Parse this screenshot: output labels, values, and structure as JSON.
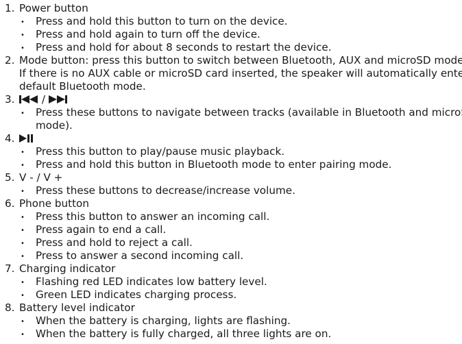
{
  "items": [
    {
      "number": "1.",
      "title": "Power button",
      "bullets": [
        "Press and hold this button to turn on the device.",
        "Press and hold again to turn off the device.",
        "Press and hold for about 8 seconds to restart the device."
      ]
    },
    {
      "number": "2.",
      "lines": [
        "Mode button: press this button to switch between Bluetooth, AUX and microSD modes.",
        "If there is no AUX cable or microSD card inserted, the speaker will automatically enter",
        "default Bluetooth mode."
      ]
    },
    {
      "number": "3.",
      "title_icons": [
        "previous-track-icon",
        "next-track-icon"
      ],
      "separator": "/",
      "bullets": [
        "Press these buttons to navigate between tracks (available in Bluetooth and microSD",
        "mode)."
      ]
    },
    {
      "number": "4.",
      "title_icons": [
        "play-pause-icon"
      ],
      "bullets": [
        "Press this button to play/pause music playback.",
        "Press and hold this button in Bluetooth mode to enter pairing mode."
      ]
    },
    {
      "number": "5.",
      "title": "V - / V +",
      "bullets": [
        "Press these buttons to decrease/increase volume."
      ]
    },
    {
      "number": "6.",
      "title": "Phone button",
      "bullets": [
        "Press this button to answer an incoming call.",
        "Press again to end a call.",
        "Press and hold to reject a call.",
        "Press to answer a second incoming call."
      ]
    },
    {
      "number": "7.",
      "title": "Charging indicator",
      "bullets": [
        "Flashing red LED indicates low battery level.",
        "Green LED indicates charging process."
      ]
    },
    {
      "number": "8.",
      "title": "Battery level indicator",
      "bullets": [
        "When the battery is charging, lights are flashing.",
        "When the battery is fully charged, all three lights are on."
      ]
    }
  ],
  "bullet_glyph": "•"
}
